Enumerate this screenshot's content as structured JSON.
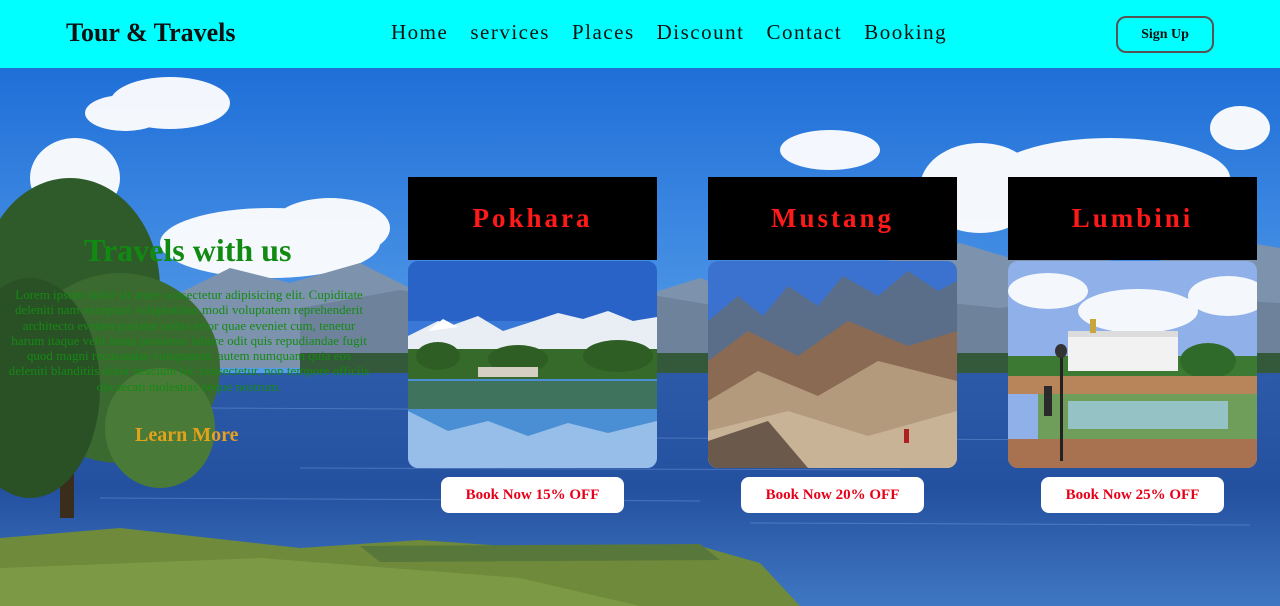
{
  "nav": {
    "logo": "Tour & Travels",
    "links": [
      "Home",
      "services",
      "Places",
      "Discount",
      "Contact",
      "Booking"
    ],
    "signup": "Sign Up"
  },
  "hero": {
    "title": "Travels with us",
    "text": "Lorem ipsum dolor sit amet consectetur adipisicing elit. Cupiditate deleniti nam excepturi voluptatibus modi voluptatem reprehenderit architecto eveniet pariatur nobis error quae eveniet cum, tenetur harum itaque velit natus possimus labore odit quis repudiandae fugit quod magni recusandae voluptatem, autem numquam quia eos deleniti blanditiis dolor nesciunt hic consectetur, non tempore officiis obcaecati molestias neque nostrum.",
    "cta": "Learn More"
  },
  "cards": [
    {
      "title": "Pokhara",
      "button": "Book Now 15% OFF"
    },
    {
      "title": "Mustang",
      "button": "Book Now 20% OFF"
    },
    {
      "title": "Lumbini",
      "button": "Book Now 25% OFF"
    }
  ],
  "colors": {
    "navbar": "#00ffff",
    "hero_title": "#118a11",
    "cta": "#e4a11b",
    "card_title": "#ff1a1a",
    "button_text": "#e8001a"
  }
}
